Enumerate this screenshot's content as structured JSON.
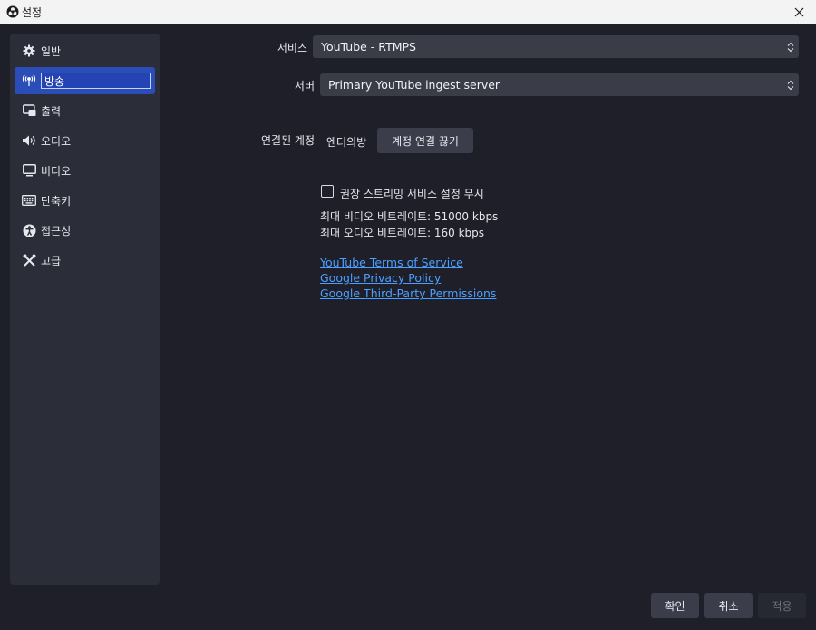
{
  "window": {
    "title": "설정",
    "close_glyph": "✕"
  },
  "sidebar": {
    "items": [
      {
        "label": "일반",
        "icon": "gear-icon"
      },
      {
        "label": "방송",
        "icon": "broadcast-icon",
        "active": true
      },
      {
        "label": "출력",
        "icon": "output-icon"
      },
      {
        "label": "오디오",
        "icon": "speaker-icon"
      },
      {
        "label": "비디오",
        "icon": "monitor-icon"
      },
      {
        "label": "단축키",
        "icon": "keyboard-icon"
      },
      {
        "label": "접근성",
        "icon": "accessibility-icon"
      },
      {
        "label": "고급",
        "icon": "wrench-icon"
      }
    ]
  },
  "form": {
    "service_label": "서비스",
    "service_value": "YouTube - RTMPS",
    "server_label": "서버",
    "server_value": "Primary YouTube ingest server",
    "account_label": "연결된 계정",
    "account_name": "엔터의방",
    "disconnect_button": "계정 연결 끊기",
    "ignore_recommended_label": "권장 스트리밍 서비스 설정 무시",
    "ignore_recommended_checked": false,
    "max_video_bitrate": "최대 비디오 비트레이트: 51000 kbps",
    "max_audio_bitrate": "최대 오디오 비트레이트: 160 kbps"
  },
  "links": {
    "terms": "YouTube Terms of Service",
    "privacy": "Google Privacy Policy",
    "third_party": "Google Third-Party Permissions"
  },
  "footer": {
    "ok": "확인",
    "cancel": "취소",
    "apply": "적용"
  },
  "colors": {
    "accent": "#2a4db8",
    "background": "#1e1f28",
    "panel": "#2b2e38",
    "control": "#3a3d48",
    "link": "#4d9fff"
  }
}
